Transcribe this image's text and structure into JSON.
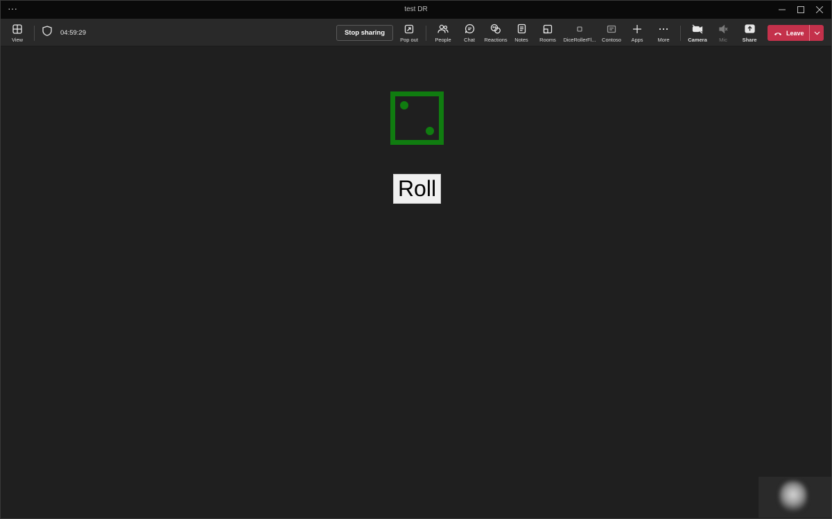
{
  "window": {
    "title": "test DR",
    "menu_glyph": "···"
  },
  "toolbar": {
    "view_label": "View",
    "timer": "04:59:29",
    "stop_sharing_label": "Stop sharing",
    "items": {
      "popout": "Pop out",
      "people": "People",
      "chat": "Chat",
      "reactions": "Reactions",
      "notes": "Notes",
      "rooms": "Rooms",
      "dice_app": "DiceRollerFl...",
      "contoso": "Contoso",
      "apps": "Apps",
      "more": "More",
      "camera": "Camera",
      "mic": "Mic",
      "share": "Share"
    },
    "leave_label": "Leave"
  },
  "stage": {
    "dice_face_value": 2,
    "dice_color": "#107c10",
    "roll_button_label": "Roll"
  },
  "colors": {
    "leave": "#c4314b",
    "toolbar_bg": "#292929",
    "stage_bg": "#1f1f1f"
  }
}
